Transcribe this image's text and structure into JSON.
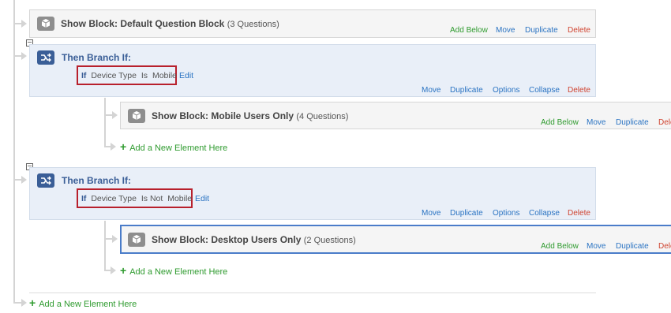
{
  "blocks": {
    "default": {
      "title": "Show Block: Default Question Block",
      "count": "(3 Questions)",
      "add_below": "Add Below",
      "move": "Move",
      "duplicate": "Duplicate",
      "delete": "Delete"
    },
    "mobile": {
      "title": "Show Block: Mobile Users Only",
      "count": "(4 Questions)",
      "add_below": "Add Below",
      "move": "Move",
      "duplicate": "Duplicate",
      "delete": "Dele"
    },
    "desktop": {
      "title": "Show Block: Desktop Users Only",
      "count": "(2 Questions)",
      "add_below": "Add Below",
      "move": "Move",
      "duplicate": "Duplicate",
      "delete": "Dele"
    }
  },
  "branches": [
    {
      "title": "Then Branch If:",
      "if": "If",
      "field": "Device Type",
      "operator": "Is",
      "value": "Mobile",
      "edit": "Edit",
      "move": "Move",
      "duplicate": "Duplicate",
      "options": "Options",
      "collapse": "Collapse",
      "delete": "Delete",
      "toggle": "−",
      "add_element": "Add a New Element Here"
    },
    {
      "title": "Then Branch If:",
      "if": "If",
      "field": "Device Type",
      "operator": "Is Not",
      "value": "Mobile",
      "edit": "Edit",
      "move": "Move",
      "duplicate": "Duplicate",
      "options": "Options",
      "collapse": "Collapse",
      "delete": "Delete",
      "toggle": "−",
      "add_element": "Add a New Element Here"
    }
  ],
  "root_add_element": "Add a New Element Here",
  "colors": {
    "branch_accent": "#3a5e97",
    "add_green": "#2f9b2f",
    "link_blue": "#2a73c2",
    "delete_red": "#d0432f",
    "highlight_red": "#b8202c"
  },
  "icons": {
    "block": "cube-icon",
    "branch": "branch-icon",
    "add": "plus-icon",
    "collapse": "minus-square-icon"
  }
}
